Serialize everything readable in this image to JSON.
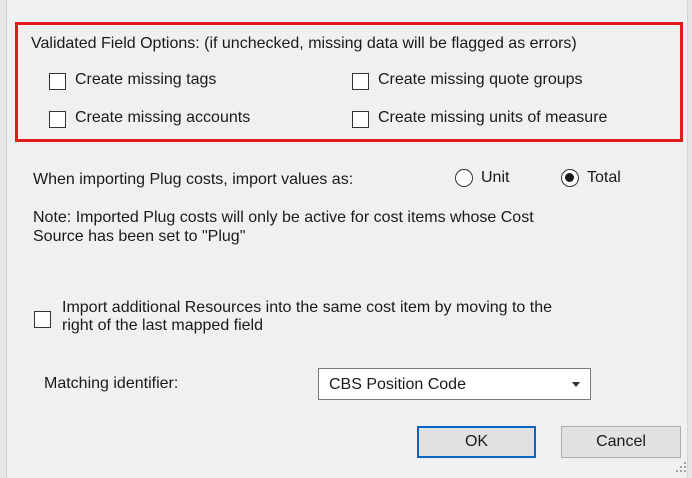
{
  "validated": {
    "heading": "Validated Field Options:  (if unchecked, missing data will be flagged as errors)",
    "options": [
      {
        "label": "Create missing tags",
        "checked": false
      },
      {
        "label": "Create missing quote groups",
        "checked": false
      },
      {
        "label": "Create missing accounts",
        "checked": false
      },
      {
        "label": "Create missing units of measure",
        "checked": false
      }
    ],
    "highlight_color": "#e01b1b"
  },
  "plug": {
    "prompt": "When importing Plug costs, import values as:",
    "options": [
      {
        "label": "Unit",
        "selected": false
      },
      {
        "label": "Total",
        "selected": true
      }
    ],
    "note_line1": "Note: Imported Plug costs will only be active for cost items whose Cost",
    "note_line2": "Source has been set to \"Plug\""
  },
  "resources": {
    "label_line1": "Import additional Resources into the same cost item by moving to the",
    "label_line2": "right of the last mapped field",
    "checked": false
  },
  "matching": {
    "label": "Matching identifier:",
    "selected": "CBS Position Code"
  },
  "buttons": {
    "ok": "OK",
    "cancel": "Cancel"
  }
}
